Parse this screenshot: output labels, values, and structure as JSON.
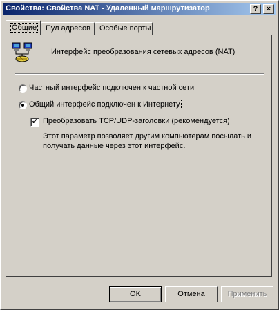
{
  "window": {
    "title": "Свойства: Свойства NAT - Удаленный маршрутизатор",
    "help_glyph": "?",
    "close_glyph": "×"
  },
  "tabs": [
    {
      "label": "Общие",
      "active": true
    },
    {
      "label": "Пул адресов",
      "active": false
    },
    {
      "label": "Особые порты",
      "active": false
    }
  ],
  "header": {
    "icon": "network-computers-icon",
    "label": "Интерфейс преобразования сетевых адресов (NAT)"
  },
  "options": {
    "private": {
      "label": "Частный интерфейс подключен к частной сети",
      "selected": false
    },
    "public": {
      "label": "Общий интерфейс подключен к Интернету",
      "selected": true
    }
  },
  "translate_headers": {
    "label": "Преобразовать TCP/UDP-заголовки (рекомендуется)",
    "checked": true,
    "check_glyph": "✔",
    "description": "Этот параметр позволяет другим компьютерам посылать и получать данные через этот интерфейс."
  },
  "buttons": {
    "ok": "OK",
    "cancel": "Отмена",
    "apply": "Применить"
  }
}
